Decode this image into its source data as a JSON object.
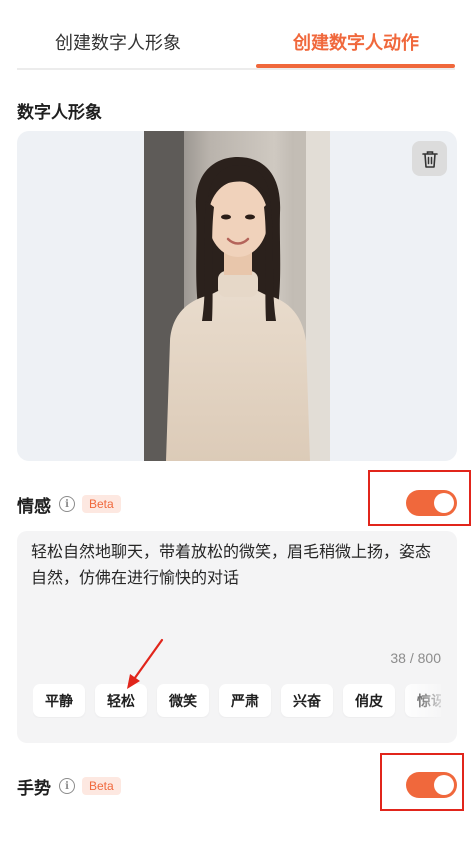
{
  "tabs": [
    {
      "label": "创建数字人形象",
      "active": false
    },
    {
      "label": "创建数字人动作",
      "active": true
    }
  ],
  "avatar_section": {
    "title": "数字人形象",
    "delete_icon": "trash-icon"
  },
  "emotion": {
    "label": "情感",
    "badge": "Beta",
    "info_icon": "info-icon",
    "text": "轻松自然地聊天，带着放松的微笑，眉毛稍微上扬，姿态自然，仿佛在进行愉快的对话",
    "char_count": "38 / 800",
    "enabled": true,
    "chips": [
      "平静",
      "轻松",
      "微笑",
      "严肃",
      "兴奋",
      "俏皮",
      "惊讶"
    ]
  },
  "gesture": {
    "label": "手势",
    "badge": "Beta",
    "info_icon": "info-icon",
    "enabled": true
  },
  "colors": {
    "accent": "#f0683c",
    "annotation_red": "#e1251b",
    "card_bg": "#f4f4f5"
  }
}
